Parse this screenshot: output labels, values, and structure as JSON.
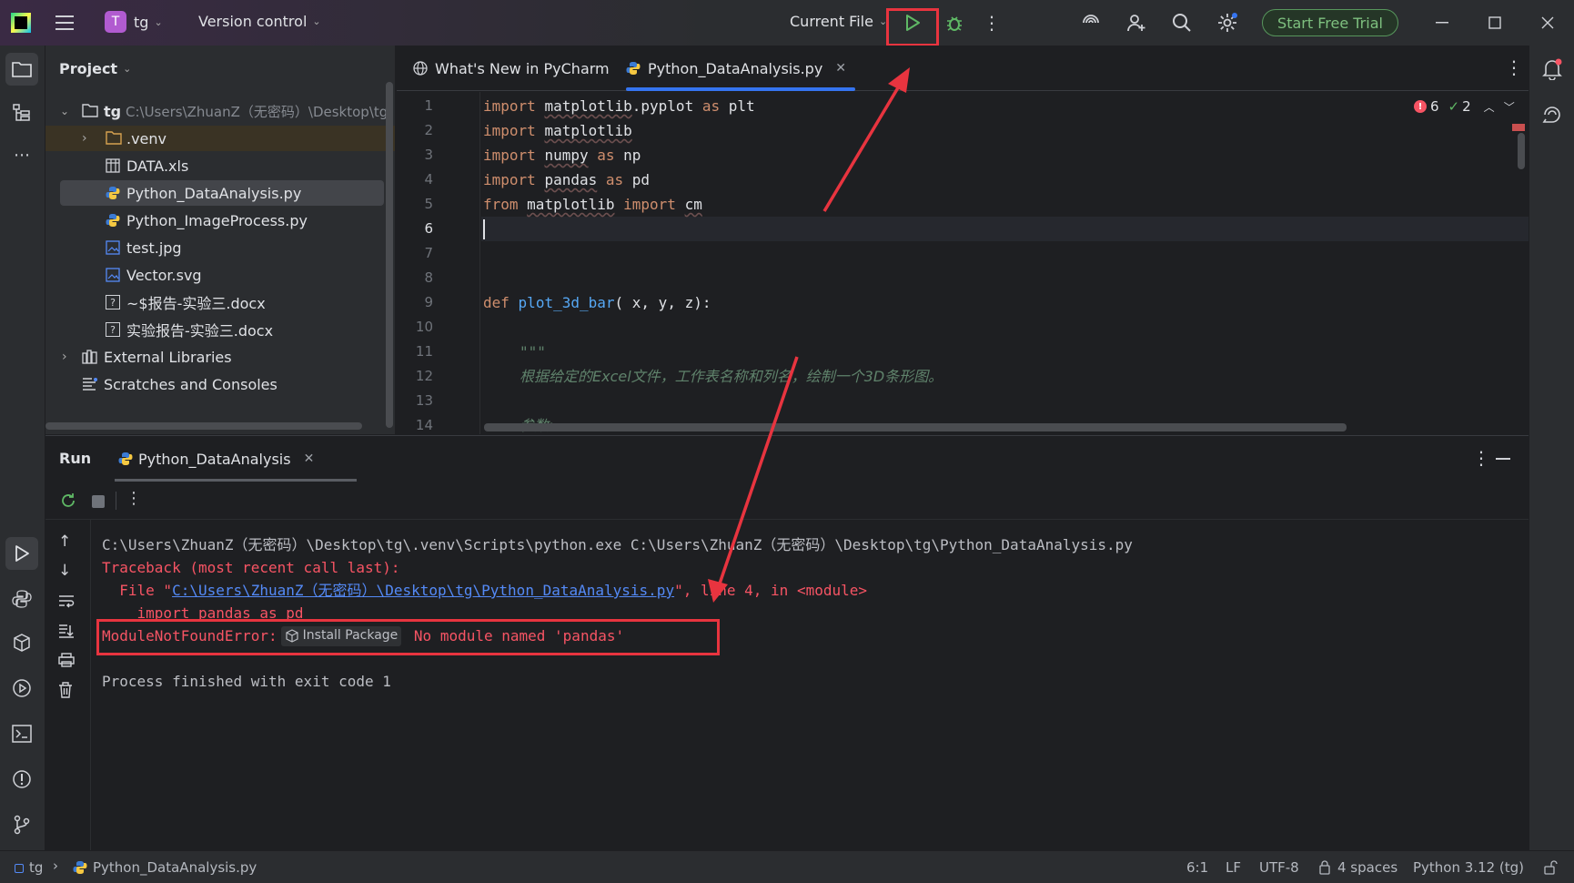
{
  "titlebar": {
    "project_badge": "T",
    "project_name": "tg",
    "version_control": "Version control",
    "run_config": "Current File",
    "trial_button": "Start Free Trial"
  },
  "project_panel": {
    "title": "Project",
    "root": {
      "name": "tg",
      "path": "C:\\Users\\ZhuanZ（无密码）\\Desktop\\tg"
    },
    "items": [
      {
        "label": ".venv",
        "icon": "folder-icon"
      },
      {
        "label": "DATA.xls",
        "icon": "table-file-icon"
      },
      {
        "label": "Python_DataAnalysis.py",
        "icon": "python-file-icon"
      },
      {
        "label": "Python_ImageProcess.py",
        "icon": "python-file-icon"
      },
      {
        "label": "test.jpg",
        "icon": "image-file-icon"
      },
      {
        "label": "Vector.svg",
        "icon": "image-file-icon"
      },
      {
        "label": "~$报告-实验三.docx",
        "icon": "unknown-file-icon"
      },
      {
        "label": "实验报告-实验三.docx",
        "icon": "unknown-file-icon"
      }
    ],
    "external_libraries": "External Libraries",
    "scratches": "Scratches and Consoles"
  },
  "editor": {
    "tabs": [
      {
        "label": "What's New in PyCharm"
      },
      {
        "label": "Python_DataAnalysis.py"
      }
    ],
    "inspections": {
      "errors": "6",
      "warnings": "2"
    },
    "line_numbers": [
      "1",
      "2",
      "3",
      "4",
      "5",
      "6",
      "7",
      "8",
      "9",
      "10",
      "11",
      "12",
      "13",
      "14"
    ],
    "code": {
      "l1": [
        "import",
        "matplotlib",
        ".pyplot ",
        "as",
        " plt"
      ],
      "l2": [
        "import",
        "matplotlib"
      ],
      "l3": [
        "import",
        "numpy",
        "as",
        "np"
      ],
      "l4": [
        "import",
        "pandas",
        "as",
        "pd"
      ],
      "l5": [
        "from",
        "matplotlib",
        "import",
        "cm"
      ],
      "l9": [
        "def",
        "plot_3d_bar",
        "( x, y, z):"
      ],
      "l11": "\"\"\"",
      "l12": "根据给定的Excel文件，工作表名称和列名，绘制一个3D条形图。",
      "l14": "参数:"
    }
  },
  "run_panel": {
    "title": "Run",
    "tab_label": "Python_DataAnalysis",
    "output": {
      "cmd": "C:\\Users\\ZhuanZ（无密码）\\Desktop\\tg\\.venv\\Scripts\\python.exe C:\\Users\\ZhuanZ（无密码）\\Desktop\\tg\\Python_DataAnalysis.py",
      "traceback": "Traceback (most recent call last):",
      "file_prefix": "  File \"",
      "file_link": "C:\\Users\\ZhuanZ（无密码）\\Desktop\\tg\\Python_DataAnalysis.py",
      "file_suffix": "\", line 4, in <module>",
      "import_line": "    import pandas as pd",
      "error_name": "ModuleNotFoundError:",
      "install_package": "Install Package",
      "error_msg": " No module named 'pandas'",
      "finished": "Process finished with exit code 1"
    }
  },
  "statusbar": {
    "project": "tg",
    "file": "Python_DataAnalysis.py",
    "position": "6:1",
    "line_sep": "LF",
    "encoding": "UTF-8",
    "indent": "4 spaces",
    "interpreter": "Python 3.12 (tg)"
  },
  "colors": {
    "accent": "#3574f0",
    "annotation_red": "#e8343f",
    "error_red": "#f75464",
    "trial_green": "#57965c"
  }
}
